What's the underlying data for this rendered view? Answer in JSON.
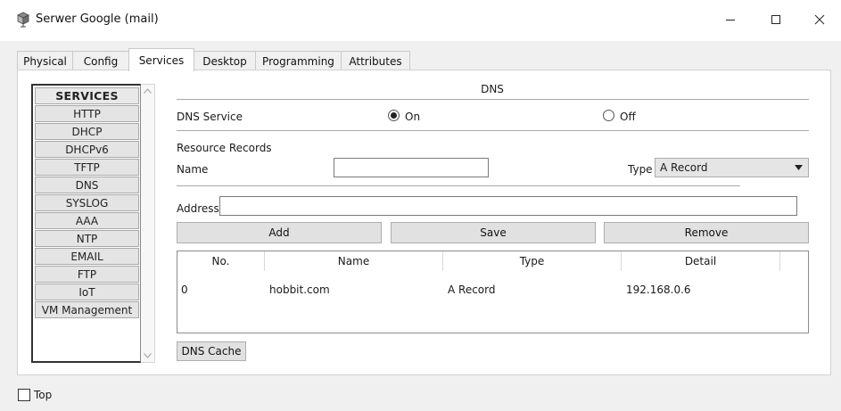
{
  "window": {
    "title": "Serwer Google (mail)",
    "icon": "server-icon"
  },
  "tabs": [
    {
      "label": "Physical",
      "active": false
    },
    {
      "label": "Config",
      "active": false
    },
    {
      "label": "Services",
      "active": true
    },
    {
      "label": "Desktop",
      "active": false
    },
    {
      "label": "Programming",
      "active": false
    },
    {
      "label": "Attributes",
      "active": false
    }
  ],
  "services": {
    "header": "SERVICES",
    "items": [
      "HTTP",
      "DHCP",
      "DHCPv6",
      "TFTP",
      "DNS",
      "SYSLOG",
      "AAA",
      "NTP",
      "EMAIL",
      "FTP",
      "IoT",
      "VM Management"
    ]
  },
  "dns": {
    "heading": "DNS",
    "service_label": "DNS Service",
    "on_label": "On",
    "off_label": "Off",
    "service_state": "On",
    "resource_records_label": "Resource Records",
    "name_label": "Name",
    "name_value": "",
    "type_label": "Type",
    "type_value": "A Record",
    "address_label": "Address",
    "address_value": "",
    "add_label": "Add",
    "save_label": "Save",
    "remove_label": "Remove",
    "dns_cache_label": "DNS Cache",
    "table": {
      "headers": [
        "No.",
        "Name",
        "Type",
        "Detail"
      ],
      "rows": [
        {
          "no": "0",
          "name": "hobbit.com",
          "type": "A Record",
          "detail": "192.168.0.6"
        }
      ]
    }
  },
  "footer": {
    "top_label": "Top",
    "top_checked": false
  }
}
